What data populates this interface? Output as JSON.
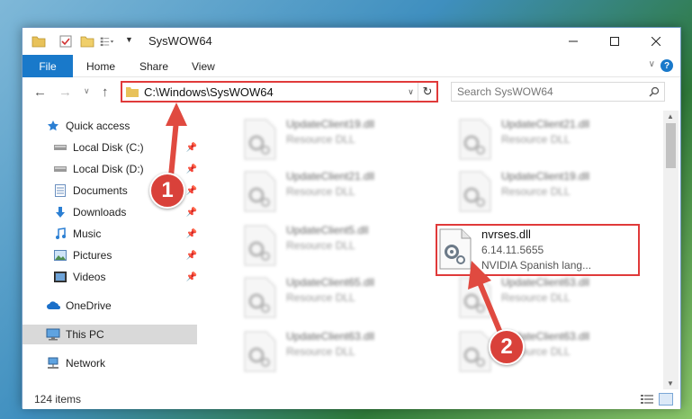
{
  "window": {
    "title": "SysWOW64",
    "controls": {
      "minimize": "minimize",
      "maximize": "maximize",
      "close": "close"
    }
  },
  "ribbon": {
    "file": "File",
    "tabs": [
      "Home",
      "Share",
      "View"
    ]
  },
  "navigation": {
    "address": "C:\\Windows\\SysWOW64",
    "search_placeholder": "Search SysWOW64"
  },
  "sidebar": {
    "items": [
      {
        "label": "Quick access",
        "icon": "star-icon"
      },
      {
        "label": "Local Disk (C:)",
        "icon": "drive-icon",
        "pinned": true
      },
      {
        "label": "Local Disk (D:)",
        "icon": "drive-icon",
        "pinned": true
      },
      {
        "label": "Documents",
        "icon": "documents-icon",
        "pinned": true
      },
      {
        "label": "Downloads",
        "icon": "download-icon",
        "pinned": true
      },
      {
        "label": "Music",
        "icon": "music-icon",
        "pinned": true
      },
      {
        "label": "Pictures",
        "icon": "pictures-icon",
        "pinned": true
      },
      {
        "label": "Videos",
        "icon": "videos-icon",
        "pinned": true
      },
      {
        "label": "OneDrive",
        "icon": "cloud-icon"
      },
      {
        "label": "This PC",
        "icon": "computer-icon",
        "selected": true
      },
      {
        "label": "Network",
        "icon": "network-icon"
      }
    ]
  },
  "files": [
    {
      "name": "UpdateClient19.dll",
      "type": "Resource DLL"
    },
    {
      "name": "UpdateClient21.dll",
      "type": "Resource DLL"
    },
    {
      "name": "UpdateClient21.dll",
      "type": "Resource DLL"
    },
    {
      "name": "UpdateClient19.dll",
      "type": "Resource DLL"
    },
    {
      "name": "UpdateClient5.dll",
      "type": "Resource DLL"
    },
    {
      "name": "nvrses.dll",
      "version": "6.14.11.5655",
      "description": "NVIDIA Spanish lang..."
    },
    {
      "name": "UpdateClient65.dll",
      "type": "Resource DLL"
    },
    {
      "name": "UpdateClient63.dll",
      "type": "Resource DLL"
    },
    {
      "name": "UpdateClient63.dll",
      "type": "Resource DLL"
    },
    {
      "name": "UpdateClient63.dll",
      "type": "Resource DLL"
    }
  ],
  "status": {
    "item_count": "124 items"
  },
  "callouts": [
    "1",
    "2"
  ],
  "colors": {
    "accent": "#1979ca",
    "highlight": "#e03a3a",
    "callout": "#d9413a"
  }
}
